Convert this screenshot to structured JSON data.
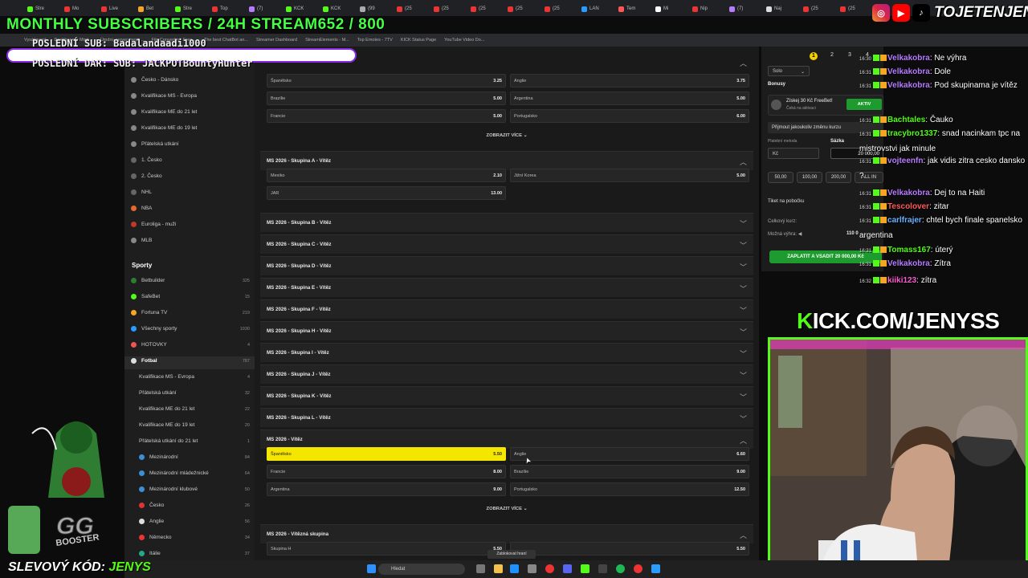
{
  "browser": {
    "tabs": [
      "Stre",
      "Mo",
      "Live",
      "Bet",
      "Stre",
      "Top",
      "(7)",
      "KCK",
      "KCK",
      "(99",
      "(25",
      "(25",
      "(25",
      "(25",
      "(25",
      "LAN",
      "Tem",
      "Mi",
      "Nip",
      "(7)",
      "Naj",
      "(25",
      "(25"
    ],
    "bookmarks": [
      "Vysáťovaní",
      "Dashboard | Mixit...",
      "Úmdni_server mesa...",
      "File Converter - Free...",
      "The best ChatBot an...",
      "Streamer Dashboard",
      "StreamElements - M...",
      "Top Emotes - 7TV",
      "KICK Status Page",
      "YouTube Video Do..."
    ]
  },
  "overlay": {
    "monthly": "MONTHLY SUBSCRIBERS / 24H STREAM652 / 800",
    "last_sub": "POSLEDNÍ SUB: Badalandaadi1000",
    "last_dar": "POSLEDNÍ DAR:      SUB: JACKPOTBountyHunter",
    "handle": "TOJETENJENYS",
    "kick": "KICK.COM/JENYSS",
    "kick_first": "K",
    "kick_rest": "ICK.COM/JENYSS",
    "slevovy_label": "SLEVOVÝ KÓD: ",
    "slevovy_code": "JENYS",
    "booster": "BOOSTER"
  },
  "sidebar": {
    "top_items": [
      {
        "label": "Česko - Dánsko"
      },
      {
        "label": "Kvalifikace MS - Evropa"
      },
      {
        "label": "Kvalifikace ME do 21 let"
      },
      {
        "label": "Kvalifikace ME do 19 let"
      },
      {
        "label": "Přátelská utkání"
      },
      {
        "label": "1. Česko"
      },
      {
        "label": "2. Česko"
      },
      {
        "label": "NHL"
      },
      {
        "label": "NBA"
      },
      {
        "label": "Euroliga - muži"
      },
      {
        "label": "MLB"
      }
    ],
    "sports_heading": "Sporty",
    "sports": [
      {
        "label": "Betbuilder",
        "count": "325"
      },
      {
        "label": "SafeBet",
        "count": "15"
      },
      {
        "label": "Fortuna TV",
        "count": "219"
      },
      {
        "label": "Všechny sporty",
        "count": "1930"
      },
      {
        "label": "HOTOVKY",
        "count": "4"
      },
      {
        "label": "Fotbal",
        "count": "787"
      }
    ],
    "football_sub": [
      {
        "label": "Kvalifikace MS - Evropa",
        "count": "4"
      },
      {
        "label": "Přátelská utkání",
        "count": "32"
      },
      {
        "label": "Kvalifikace ME do 21 let",
        "count": "22"
      },
      {
        "label": "Kvalifikace ME do 19 let",
        "count": "20"
      },
      {
        "label": "Přátelská utkání do 21 let",
        "count": "1"
      },
      {
        "label": "Mezinárodní",
        "count": "84"
      },
      {
        "label": "Mezinárodní mládežnické",
        "count": "64"
      },
      {
        "label": "Mezinárodní klubové",
        "count": "50"
      },
      {
        "label": "Česko",
        "count": "26"
      },
      {
        "label": "Anglie",
        "count": "56"
      },
      {
        "label": "Německo",
        "count": "34"
      },
      {
        "label": "Itálie",
        "count": "37"
      }
    ]
  },
  "main": {
    "top_odds": [
      {
        "team": "Španělsko",
        "odd": "3.25"
      },
      {
        "team": "Anglie",
        "odd": "3.75"
      },
      {
        "team": "Brazílie",
        "odd": "5.00"
      },
      {
        "team": "Argentina",
        "odd": "5.00"
      },
      {
        "team": "Francie",
        "odd": "5.00"
      },
      {
        "team": "Portugalsko",
        "odd": "6.00"
      }
    ],
    "show_more": "ZOBRAZIT VÍCE",
    "group_a_title": "MS 2026 - Skupina A - Vítěz",
    "group_a_odds": [
      {
        "team": "Mexiko",
        "odd": "2.10"
      },
      {
        "team": "Jižní Korea",
        "odd": "5.00"
      },
      {
        "team": "JAR",
        "odd": "13.00"
      }
    ],
    "collapsed": [
      "MS 2026 - Skupina B - Vítěz",
      "MS 2026 - Skupina C - Vítěz",
      "MS 2026 - Skupina D - Vítěz",
      "MS 2026 - Skupina E - Vítěz",
      "MS 2026 - Skupina F - Vítěz",
      "MS 2026 - Skupina H - Vítěz",
      "MS 2026 - Skupina I - Vítěz",
      "MS 2026 - Skupina J - Vítěz",
      "MS 2026 - Skupina K - Vítěz",
      "MS 2026 - Skupina L - Vítěz"
    ],
    "winner_title": "MS 2026 - Vítěz",
    "winner_odds": [
      {
        "team": "Španělsko",
        "odd": "5.50"
      },
      {
        "team": "Anglie",
        "odd": "6.60"
      },
      {
        "team": "Francie",
        "odd": "8.00"
      },
      {
        "team": "Brazílie",
        "odd": "9.00"
      },
      {
        "team": "Argentina",
        "odd": "9.00"
      },
      {
        "team": "Portugalsko",
        "odd": "12.50"
      }
    ],
    "winning_group_title": "MS 2026 - Vítězná skupina",
    "winning_group_odds": [
      {
        "team": "Skupina H",
        "odd": "5.50"
      }
    ]
  },
  "betslip": {
    "pages": [
      "1",
      "2",
      "3",
      "4"
    ],
    "mode": "Solo",
    "bonusy": "Bonusy",
    "freebet": "Získej 30 Kč FreeBet!",
    "freebet_sub": "Čeká na aktivaci",
    "activate": "AKTIV",
    "accept_changes": "Přijmout jakoukoliv změnu kurzu",
    "payment_label": "Platební metoda",
    "stake_label": "Sázka",
    "currency": "Kč",
    "stake_value": "20 000,00",
    "chips": [
      "50,00",
      "100,00",
      "200,00"
    ],
    "all_in": "ALL IN",
    "ticket": "Tiket na pobočku",
    "total_odds_label": "Celkový kurz:",
    "possible_win_label": "Možná výhra:",
    "possible_win_value": "110 0",
    "pay_button": "ZAPLATIT A VSADIT 20 000,00 Kč"
  },
  "chat": [
    {
      "time": "16:30",
      "user": "Velkakobra",
      "color": "#b77bff",
      "msg": ": Ne výhra"
    },
    {
      "time": "16:31",
      "user": "Velkakobra",
      "color": "#b77bff",
      "msg": ": Dole"
    },
    {
      "time": "16:31",
      "user": "Velkakobra",
      "color": "#b77bff",
      "msg": ": Pod skupinama je vítěz"
    },
    {
      "time": "16:31",
      "user": "Bachtales",
      "color": "#53fc18",
      "msg": ": Čauko"
    },
    {
      "time": "16:31",
      "user": "tracybro1337",
      "color": "#53fc18",
      "msg": ": snad nacinkam tpc na mistrovstvi jak minule"
    },
    {
      "time": "16:31",
      "user": "vojteenfn",
      "color": "#b77bff",
      "msg": ": jak vidis zitra cesko dansko ?"
    },
    {
      "time": "16:31",
      "user": "Velkakobra",
      "color": "#b77bff",
      "msg": ": Dej to na Haiti"
    },
    {
      "time": "16:31",
      "user": "Tescolover",
      "color": "#ff5a5a",
      "msg": ": zitar"
    },
    {
      "time": "16:31",
      "user": "carlfrajer",
      "color": "#6ab0ff",
      "msg": ": chtel bych finale spanelsko argentina"
    },
    {
      "time": "16:31",
      "user": "Tomass167",
      "color": "#53fc18",
      "msg": ": úterý"
    },
    {
      "time": "16:31",
      "user": "Velkakobra",
      "color": "#b77bff",
      "msg": ": Zítra"
    },
    {
      "time": "16:32",
      "user": "kiiki123",
      "color": "#ff5ad0",
      "msg": ": zítra"
    }
  ],
  "taskbar": {
    "search": "Hledat",
    "tooltip": "Zablokovat hraní"
  },
  "colors": {
    "accent": "#53fc18",
    "highlight": "#f5e600",
    "pay": "#1e9b2e"
  }
}
